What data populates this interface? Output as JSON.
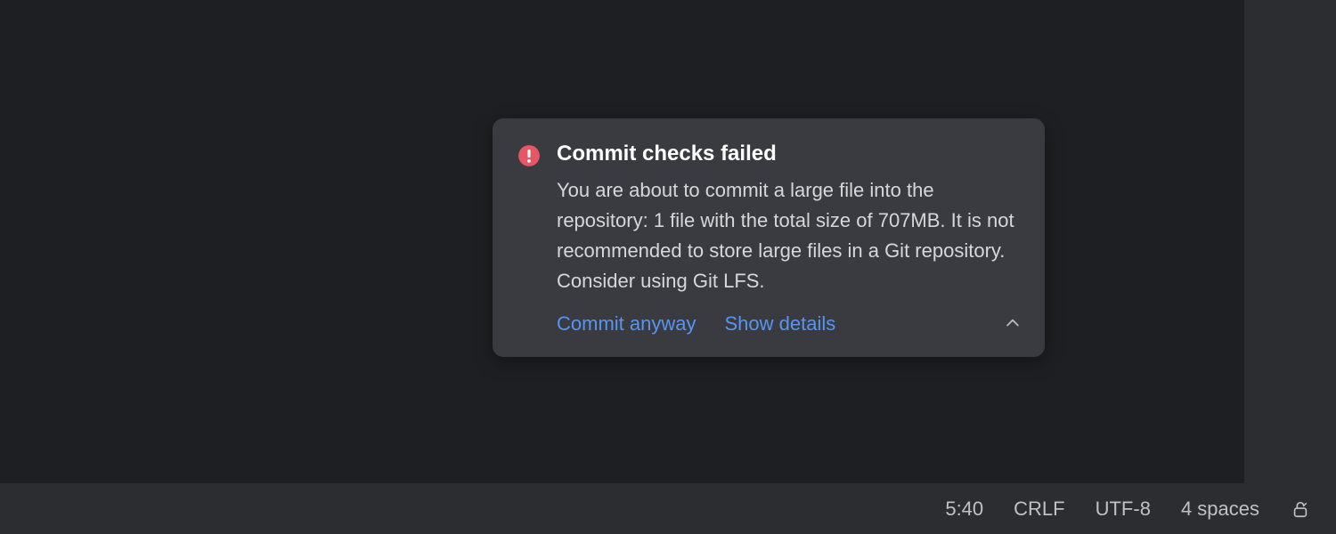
{
  "notification": {
    "title": "Commit checks failed",
    "message": "You are about to commit a large file into the repository: 1 file with the total size of 707MB. It is not recommended to store large files in a Git repository. Consider using Git LFS.",
    "actions": {
      "commit_anyway": "Commit anyway",
      "show_details": "Show details"
    },
    "icon": "error-icon",
    "icon_color": "#e55765"
  },
  "statusbar": {
    "cursor_position": "5:40",
    "line_separator": "CRLF",
    "encoding": "UTF-8",
    "indent": "4 spaces"
  }
}
